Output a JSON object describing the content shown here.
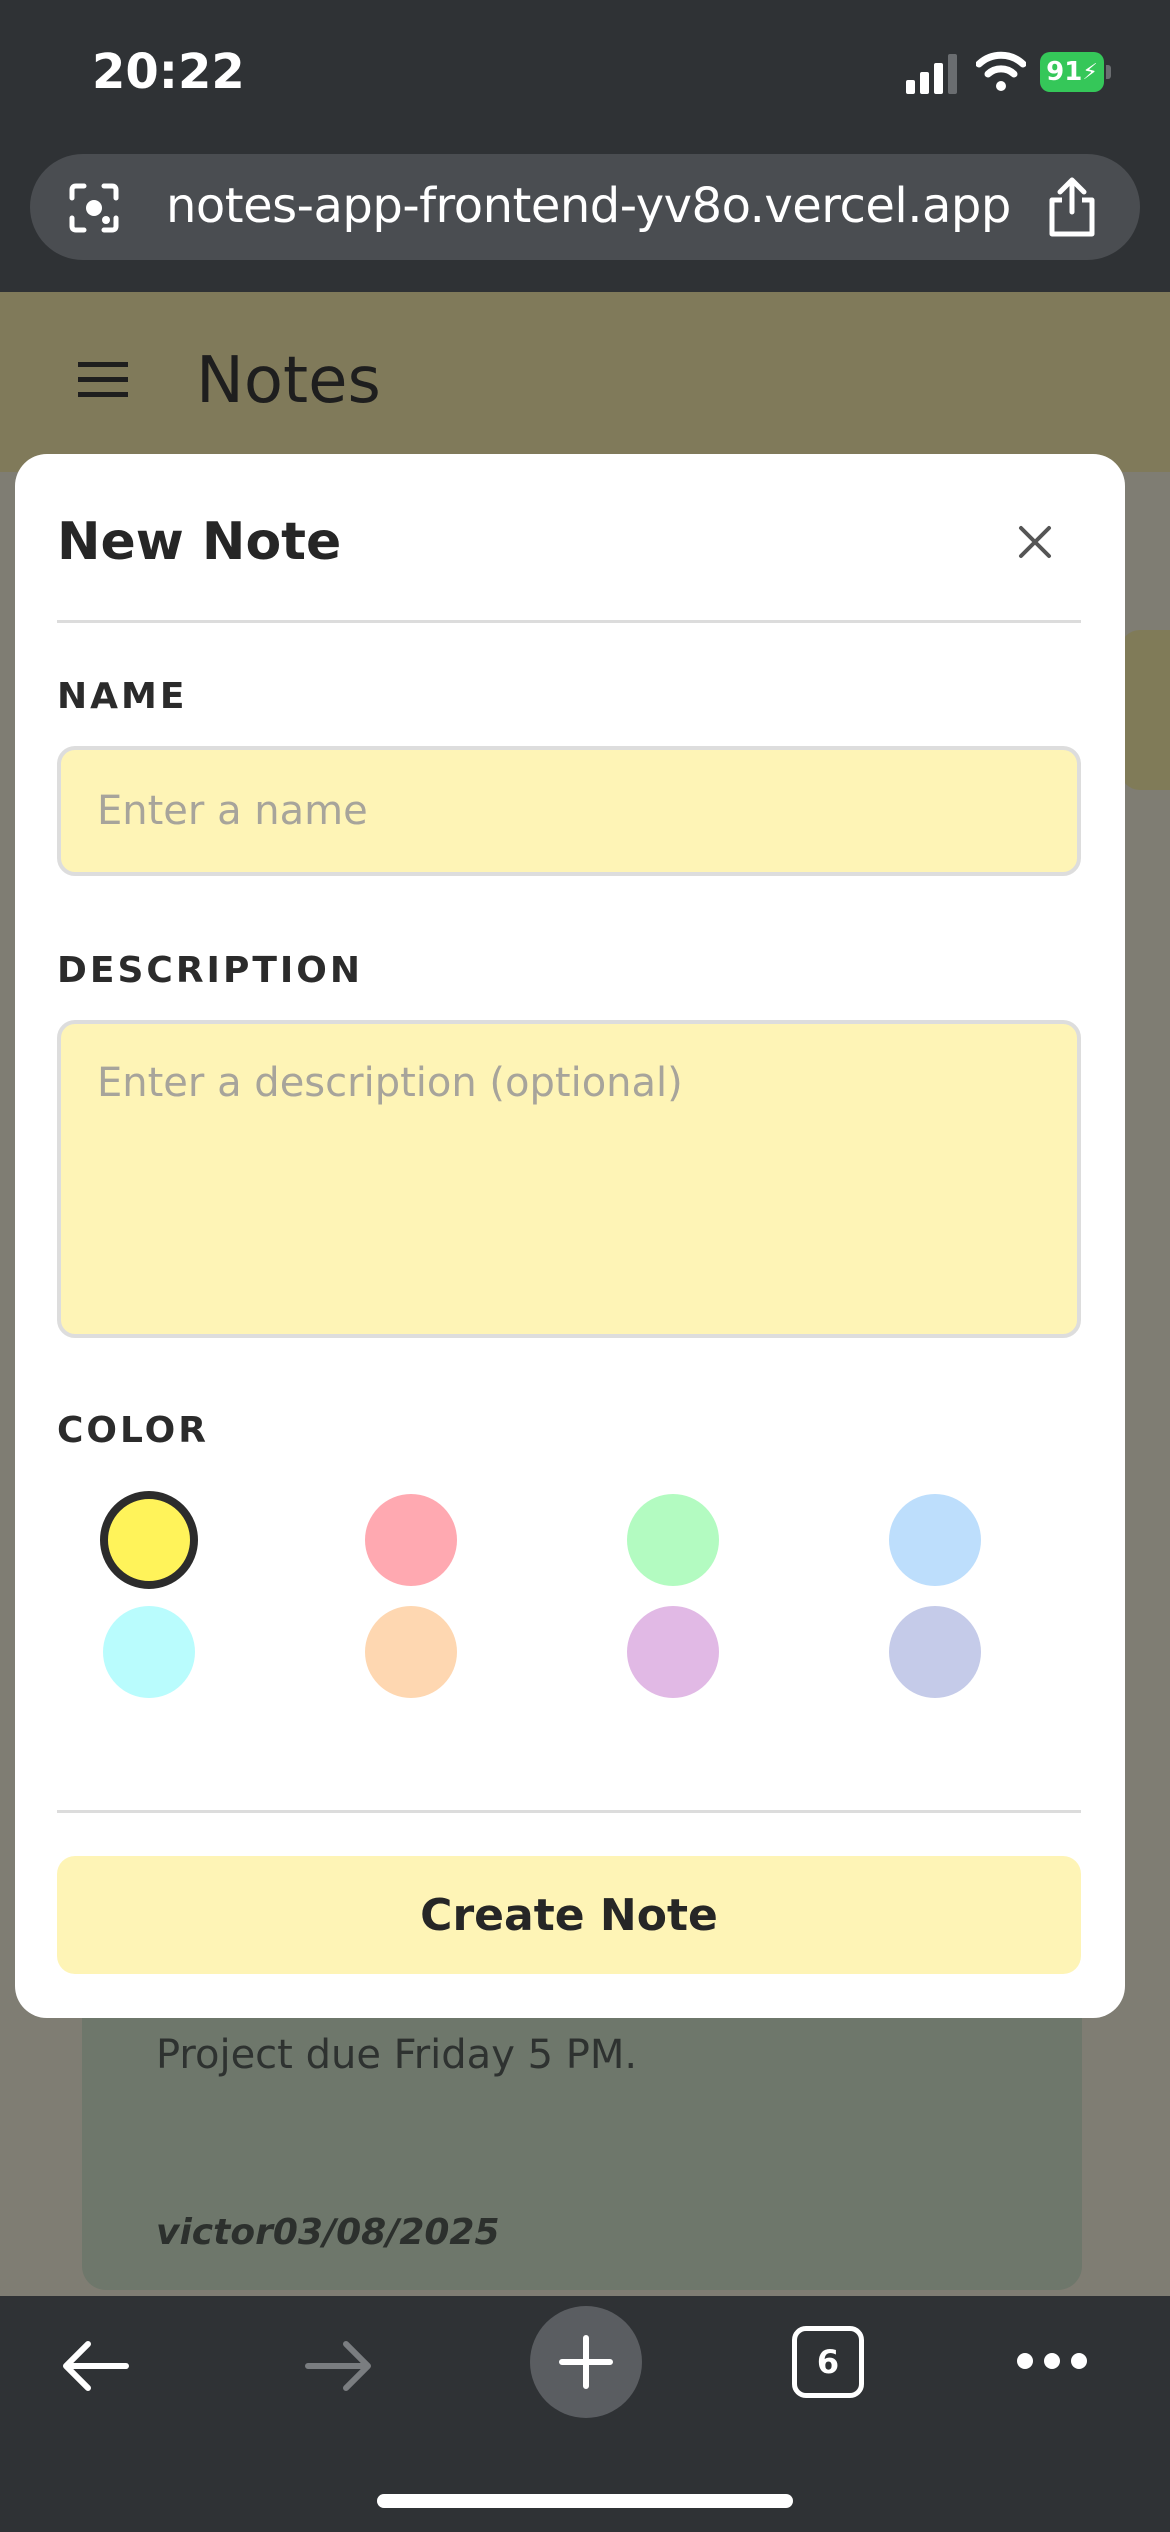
{
  "status_bar": {
    "time": "20:22",
    "battery": "91"
  },
  "browser": {
    "url": "notes-app-frontend-yv8o.vercel.app",
    "tab_count": "6"
  },
  "app": {
    "title": "Notes"
  },
  "background_note": {
    "text": "Project due Friday 5 PM.",
    "meta": "victor03/08/2025"
  },
  "modal": {
    "title": "New Note",
    "name_label": "NAME",
    "name_placeholder": "Enter a name",
    "description_label": "DESCRIPTION",
    "description_placeholder": "Enter a description (optional)",
    "color_label": "COLOR",
    "colors": [
      "#fff35a",
      "#ffa9b1",
      "#b3fbc1",
      "#bddefc",
      "#b9fcfd",
      "#fed7b1",
      "#e1b9e5",
      "#c5cbe9"
    ],
    "selected_color_index": 0,
    "create_label": "Create Note"
  }
}
